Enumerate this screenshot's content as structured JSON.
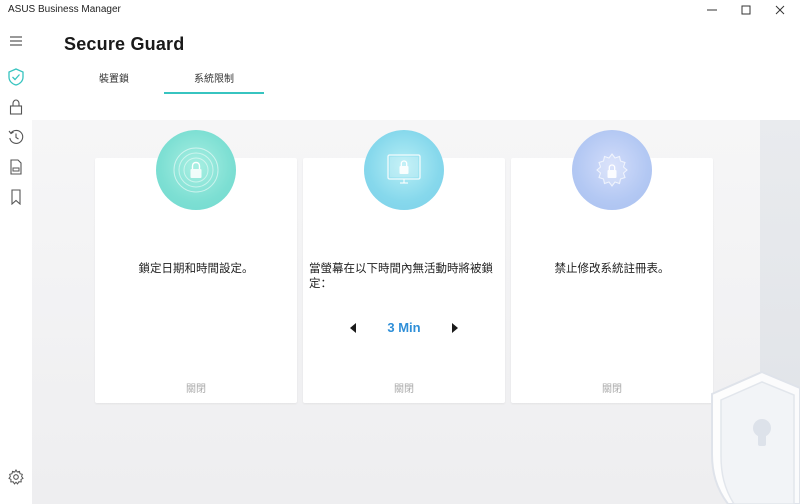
{
  "window": {
    "title": "ASUS Business Manager",
    "controls": [
      "minimize-icon",
      "maximize-icon",
      "close-icon"
    ]
  },
  "sidebar": {
    "items": [
      {
        "icon": "menu-icon"
      },
      {
        "icon": "shield-check-icon",
        "active": true
      },
      {
        "icon": "lock-icon"
      },
      {
        "icon": "history-icon"
      },
      {
        "icon": "document-icon"
      },
      {
        "icon": "bookmark-icon"
      },
      {
        "icon": "gear-icon"
      }
    ]
  },
  "header": {
    "title": "Secure Guard",
    "tabs": [
      {
        "label": "裝置鎖",
        "active": false
      },
      {
        "label": "系統限制",
        "active": true
      }
    ]
  },
  "cards": [
    {
      "icon": "lock-circle-icon",
      "text": "鎖定日期和時間設定。",
      "status": "關閉"
    },
    {
      "icon": "monitor-lock-icon",
      "text": "當螢幕在以下時間內無活動時將被鎖定：",
      "timeout": "3 Min",
      "status": "關閉"
    },
    {
      "icon": "gear-lock-icon",
      "text": "禁止修改系統註冊表。",
      "status": "關閉"
    }
  ],
  "colors": {
    "accent": "#37c4c0",
    "timeout_value": "#2f8fd8",
    "status_text": "#a8a8a8"
  }
}
